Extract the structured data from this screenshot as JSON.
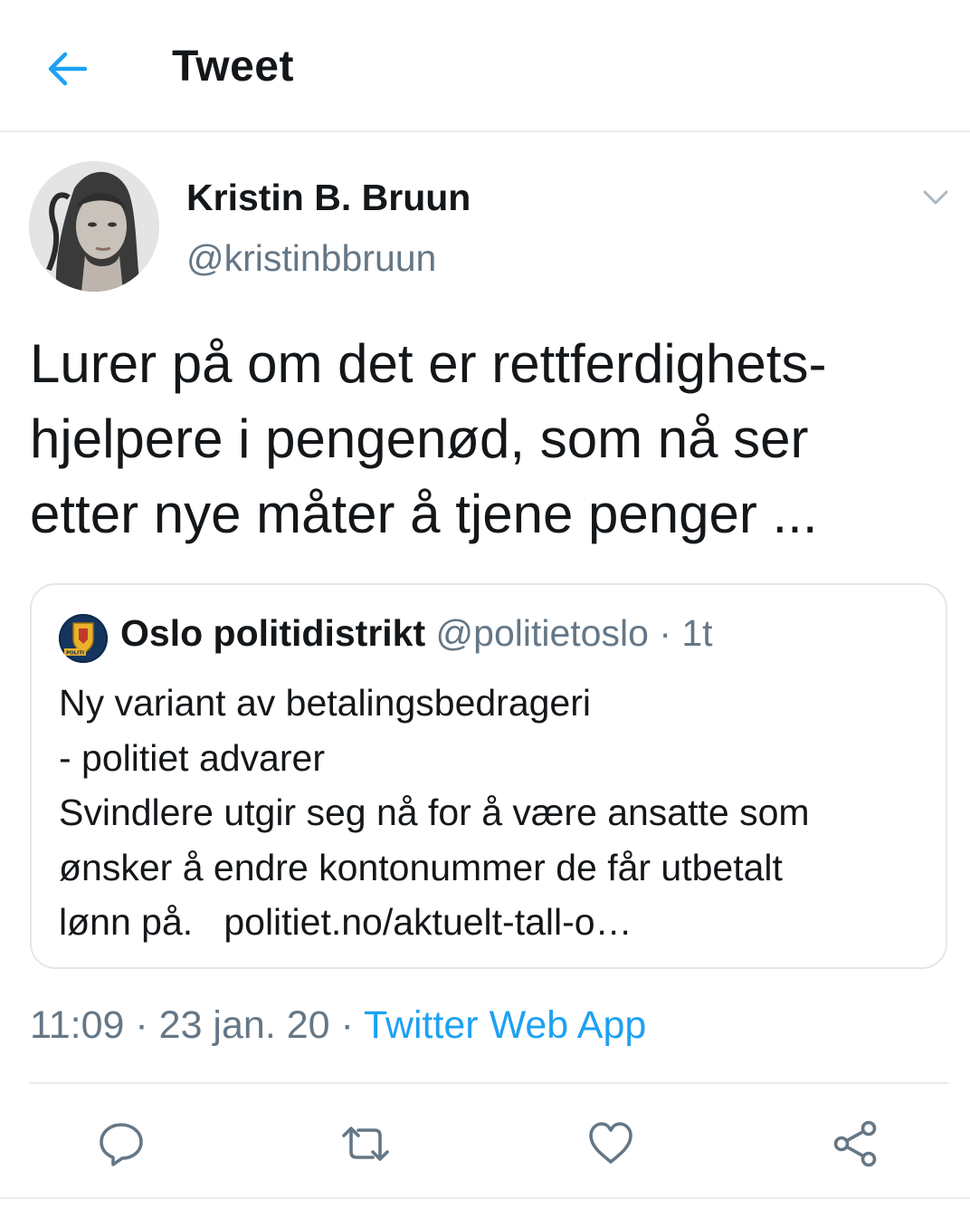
{
  "header": {
    "title": "Tweet",
    "back_icon": "arrow-left-icon"
  },
  "tweet": {
    "author_name": "Kristin B. Bruun",
    "author_handle": "@kristinbbruun",
    "text_lines": [
      "Lurer på om det er rettferdighets-",
      "hjelpere i pengenød, som nå ser",
      "etter nye måter å tjene penger ..."
    ],
    "timestamp_time": "11:09",
    "timestamp_date": "23 jan. 20",
    "source": "Twitter Web App",
    "separator": "·"
  },
  "quote": {
    "author_name": "Oslo politidistrikt",
    "author_handle": "@politietoslo",
    "time": "1t",
    "separator": "·",
    "avatar_badge_text": "POLITI",
    "lines": [
      "Ny variant av betalingsbedrageri",
      "- politiet advarer",
      "Svindlere utgir seg nå for å være ansatte som",
      "ønsker å endre kontonummer de får utbetalt"
    ],
    "last_line_prefix": "lønn på.",
    "link": "politiet.no/aktuelt-tall-o…"
  },
  "actions": [
    {
      "icon": "reply-icon"
    },
    {
      "icon": "retweet-icon"
    },
    {
      "icon": "like-icon"
    },
    {
      "icon": "share-icon"
    }
  ],
  "colors": {
    "accent": "#1da1f2",
    "secondary_text": "#657786",
    "primary_text": "#14171a",
    "divider": "#e6ecf0"
  }
}
